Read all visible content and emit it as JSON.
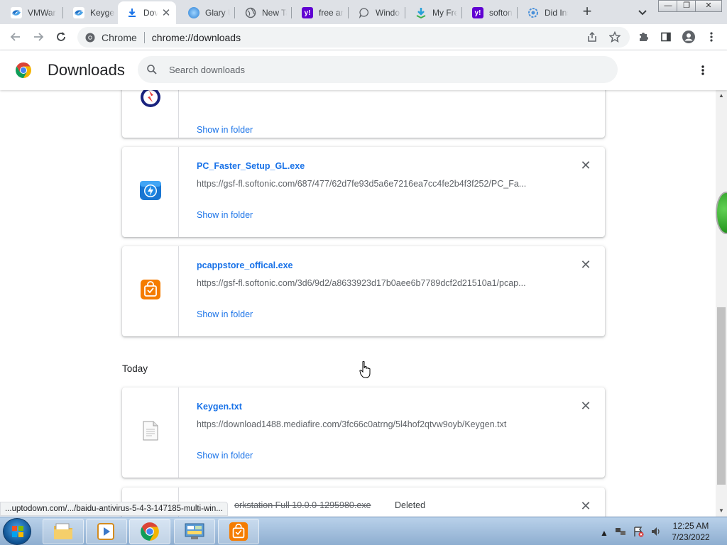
{
  "tabs": [
    {
      "label": "VMWar",
      "icon": "softonic-icon",
      "active": false
    },
    {
      "label": "Keygen",
      "icon": "softonic-icon",
      "active": false
    },
    {
      "label": "Dov",
      "icon": "download-icon",
      "active": true
    },
    {
      "label": "Glary U",
      "icon": "glary-icon",
      "active": false
    },
    {
      "label": "New Ta",
      "icon": "globe-icon",
      "active": false
    },
    {
      "label": "free ant",
      "icon": "yahoo-icon",
      "active": false
    },
    {
      "label": "Windo",
      "icon": "chat-icon",
      "active": false
    },
    {
      "label": "My Fre",
      "icon": "download-arrow-icon",
      "active": false
    },
    {
      "label": "softoni",
      "icon": "yahoo-icon",
      "active": false
    },
    {
      "label": "Did Ins",
      "icon": "gear-badge-icon",
      "active": false
    }
  ],
  "toolbar": {
    "site_chip": "Chrome",
    "url": "chrome://downloads"
  },
  "header": {
    "title": "Downloads",
    "search_placeholder": "Search downloads"
  },
  "downloads": {
    "top_partial": {
      "show_in_folder": "Show in folder"
    },
    "items": [
      {
        "filename": "PC_Faster_Setup_GL.exe",
        "url": "https://gsf-fl.softonic.com/687/477/62d7fe93d5a6e7216ea7cc4fe2b4f3f252/PC_Fa...",
        "show_in_folder": "Show in folder"
      },
      {
        "filename": "pcappstore_offical.exe",
        "url": "https://gsf-fl.softonic.com/3d6/9d2/a8633923d17b0aee6b7789dcf2d21510a1/pcap...",
        "show_in_folder": "Show in folder"
      }
    ],
    "today_label": "Today",
    "today_items": [
      {
        "filename": "Keygen.txt",
        "url": "https://download1488.mediafire.com/3fc66c0atrng/5l4hof2qtvw9oyb/Keygen.txt",
        "show_in_folder": "Show in folder"
      }
    ],
    "deleted_item": {
      "filename_partial": "orkstation Full 10.0.0-1295980.exe",
      "status": "Deleted"
    }
  },
  "status_bar": {
    "text": "...uptodown.com/.../baidu-antivirus-5-4-3-147185-multi-win..."
  },
  "taskbar": {
    "time": "12:25 AM",
    "date": "7/23/2022"
  },
  "colors": {
    "accent": "#1a73e8",
    "tab_strip": "#dee1e6",
    "omnibox": "#f1f3f4"
  }
}
